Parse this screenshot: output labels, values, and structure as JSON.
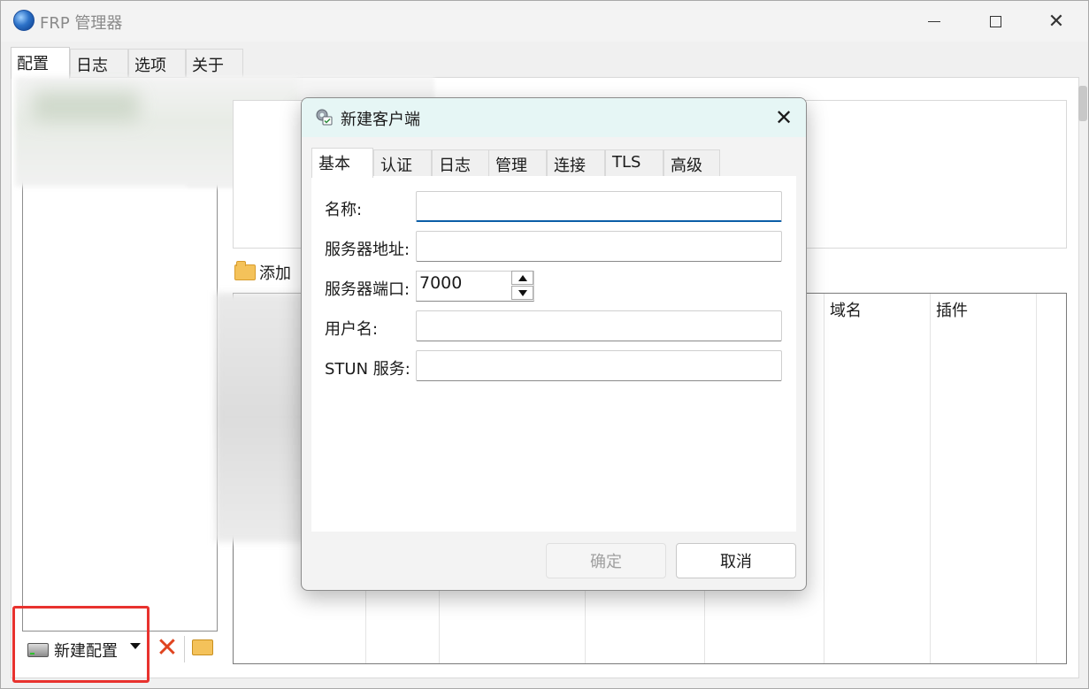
{
  "window": {
    "title": "FRP 管理器",
    "controls": [
      "minimize",
      "maximize",
      "close"
    ]
  },
  "main_tabs": [
    {
      "label": "配置",
      "active": true
    },
    {
      "label": "日志"
    },
    {
      "label": "选项"
    },
    {
      "label": "关于"
    }
  ],
  "proxy_toolbar": {
    "add_label": "添加"
  },
  "proxy_table": {
    "columns": [
      "域名",
      "插件"
    ]
  },
  "config_toolbar": {
    "new_config_label": "新建配置"
  },
  "dialog": {
    "title": "新建客户端",
    "tabs": [
      "基本",
      "认证",
      "日志",
      "管理",
      "连接",
      "TLS",
      "高级"
    ],
    "fields": {
      "name": {
        "label": "名称:",
        "value": ""
      },
      "server_addr": {
        "label": "服务器地址:",
        "value": ""
      },
      "server_port": {
        "label": "服务器端口:",
        "value": "7000"
      },
      "user": {
        "label": "用户名:",
        "value": ""
      },
      "stun": {
        "label": "STUN 服务:",
        "value": ""
      }
    },
    "ok_label": "确定",
    "cancel_label": "取消"
  },
  "colors": {
    "highlight": "#e8322e",
    "dialog_titlebar": "#e6f6f5",
    "focus": "#0b5ea8"
  }
}
